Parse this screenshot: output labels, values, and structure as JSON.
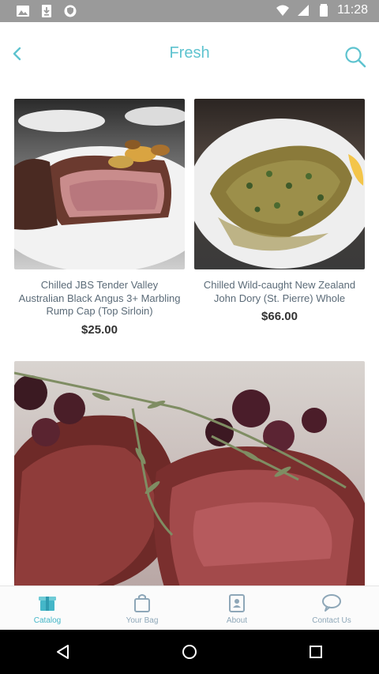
{
  "status_bar": {
    "time": "11:28",
    "left_icons": [
      "image-icon",
      "download-icon",
      "shield-icon"
    ],
    "right_icons": [
      "wifi-icon",
      "signal-icon",
      "battery-icon"
    ]
  },
  "header": {
    "title": "Fresh",
    "back_icon": "chevron-left-icon",
    "search_icon": "search-icon",
    "accent_color": "#5ec3cf"
  },
  "products": [
    {
      "name": "Chilled JBS Tender Valley Australian Black Angus 3+ Marbling Rump Cap (Top Sirloin)",
      "price": "$25.00"
    },
    {
      "name": "Chilled Wild-caught New Zealand John Dory (St. Pierre) Whole",
      "price": "$66.00"
    }
  ],
  "tabs": [
    {
      "label": "Catalog",
      "icon": "catalog-icon",
      "active": true
    },
    {
      "label": "Your Bag",
      "icon": "bag-icon",
      "active": false
    },
    {
      "label": "About",
      "icon": "about-icon",
      "active": false
    },
    {
      "label": "Contact Us",
      "icon": "chat-bubble-icon",
      "active": false
    }
  ],
  "nav_bar": [
    "back-triangle-icon",
    "home-circle-icon",
    "recents-square-icon"
  ]
}
